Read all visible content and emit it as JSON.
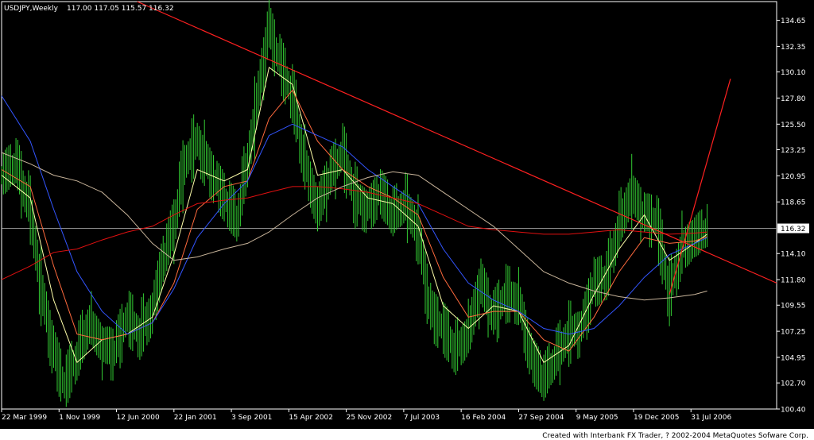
{
  "header": {
    "symbol_label": "USDJPY,Weekly",
    "ohlc": "117.00 117.05 115.57 116.32"
  },
  "footer": {
    "credit": "Created with Interbank FX Trader, ? 2002-2004 MetaQuotes Sofware Corp."
  },
  "colors": {
    "background": "#000000",
    "price_bars": "#33cc33",
    "trendline": "#ff2020",
    "ma_fast": "#ffffaa",
    "ma_medium": "#ff6a3d",
    "ma_slow_blue": "#3355ff",
    "ma_red_long": "#e01010",
    "ma_tan_long": "#c8b49a",
    "price_line": "#c0c0c0",
    "price_tag_bg": "#ffffff",
    "footer_bg": "#ffffff"
  },
  "chart_data": {
    "type": "line",
    "ylim": [
      100.4,
      136.3
    ],
    "y_ticks": [
      "134.65",
      "132.35",
      "130.10",
      "127.80",
      "125.50",
      "123.25",
      "120.95",
      "118.65",
      "116.32",
      "114.10",
      "111.80",
      "109.55",
      "107.25",
      "104.95",
      "102.70",
      "100.40"
    ],
    "y_tick_values": [
      134.65,
      132.35,
      130.1,
      127.8,
      125.5,
      123.25,
      120.95,
      118.65,
      116.32,
      114.1,
      111.8,
      109.55,
      107.25,
      104.95,
      102.7,
      100.4
    ],
    "x_ticks": [
      "22 Mar 1999",
      "1 Nov 1999",
      "12 Jun 2000",
      "22 Jan 2001",
      "3 Sep 2001",
      "15 Apr 2002",
      "25 Nov 2002",
      "7 Jul 2003",
      "16 Feb 2004",
      "27 Sep 2004",
      "9 May 2005",
      "19 Dec 2005",
      "31 Jul 2006"
    ],
    "current_price": 116.32,
    "x_range_dates": [
      "1999-03-22",
      "2007-06-30"
    ],
    "series": [
      {
        "name": "",
        "role": "price",
        "points": [
          [
            "1999-03-22",
            121.0
          ],
          [
            "1999-05-17",
            122.0
          ],
          [
            "1999-07-12",
            118.0
          ],
          [
            "1999-08-23",
            111.0
          ],
          [
            "1999-10-11",
            105.5
          ],
          [
            "1999-11-22",
            102.5
          ],
          [
            "2000-01-10",
            105.0
          ],
          [
            "2000-02-28",
            108.0
          ],
          [
            "2000-04-17",
            106.0
          ],
          [
            "2000-06-05",
            105.5
          ],
          [
            "2000-07-24",
            108.5
          ],
          [
            "2000-09-11",
            107.0
          ],
          [
            "2000-10-30",
            109.0
          ],
          [
            "2000-12-11",
            113.5
          ],
          [
            "2001-01-22",
            116.5
          ],
          [
            "2001-03-05",
            122.0
          ],
          [
            "2001-04-23",
            124.0
          ],
          [
            "2001-06-11",
            121.5
          ],
          [
            "2001-08-06",
            119.0
          ],
          [
            "2001-09-24",
            117.0
          ],
          [
            "2001-11-05",
            122.0
          ],
          [
            "2001-12-17",
            128.0
          ],
          [
            "2002-01-28",
            134.0
          ],
          [
            "2002-03-11",
            131.0
          ],
          [
            "2002-04-29",
            128.0
          ],
          [
            "2002-06-17",
            122.0
          ],
          [
            "2002-08-05",
            118.0
          ],
          [
            "2002-09-23",
            121.0
          ],
          [
            "2002-11-11",
            123.0
          ],
          [
            "2002-12-30",
            119.0
          ],
          [
            "2003-02-17",
            118.0
          ],
          [
            "2003-04-07",
            119.5
          ],
          [
            "2003-05-26",
            117.5
          ],
          [
            "2003-07-14",
            118.5
          ],
          [
            "2003-09-01",
            116.0
          ],
          [
            "2003-10-20",
            109.0
          ],
          [
            "2003-12-08",
            107.5
          ],
          [
            "2004-01-26",
            105.5
          ],
          [
            "2004-03-15",
            107.0
          ],
          [
            "2004-05-03",
            111.5
          ],
          [
            "2004-06-21",
            108.5
          ],
          [
            "2004-08-09",
            110.5
          ],
          [
            "2004-09-27",
            110.0
          ],
          [
            "2004-11-15",
            105.0
          ],
          [
            "2005-01-03",
            103.0
          ],
          [
            "2005-02-21",
            105.0
          ],
          [
            "2005-04-11",
            107.0
          ],
          [
            "2005-05-30",
            107.5
          ],
          [
            "2005-07-18",
            111.5
          ],
          [
            "2005-09-05",
            112.0
          ],
          [
            "2005-10-24",
            116.5
          ],
          [
            "2005-12-12",
            119.5
          ],
          [
            "2006-01-30",
            117.5
          ],
          [
            "2006-03-20",
            117.0
          ],
          [
            "2006-05-08",
            110.5
          ],
          [
            "2006-06-26",
            114.5
          ],
          [
            "2006-08-14",
            115.5
          ],
          [
            "2006-10-02",
            116.3
          ]
        ]
      },
      {
        "name": "",
        "role": "ma_fast",
        "points": [
          [
            "1999-03-22",
            121.0
          ],
          [
            "1999-07-12",
            119.0
          ],
          [
            "1999-10-11",
            110.0
          ],
          [
            "2000-01-10",
            104.5
          ],
          [
            "2000-04-17",
            106.5
          ],
          [
            "2000-07-24",
            107.0
          ],
          [
            "2000-10-30",
            108.5
          ],
          [
            "2001-01-22",
            114.0
          ],
          [
            "2001-04-23",
            121.5
          ],
          [
            "2001-08-06",
            120.5
          ],
          [
            "2001-11-05",
            121.5
          ],
          [
            "2002-01-28",
            130.5
          ],
          [
            "2002-04-29",
            129.0
          ],
          [
            "2002-08-05",
            121.0
          ],
          [
            "2002-11-11",
            121.5
          ],
          [
            "2003-02-17",
            119.0
          ],
          [
            "2003-05-26",
            118.5
          ],
          [
            "2003-09-01",
            116.5
          ],
          [
            "2003-12-08",
            109.5
          ],
          [
            "2004-03-15",
            107.5
          ],
          [
            "2004-06-21",
            109.5
          ],
          [
            "2004-09-27",
            109.0
          ],
          [
            "2005-01-03",
            104.5
          ],
          [
            "2005-04-11",
            106.0
          ],
          [
            "2005-07-18",
            110.5
          ],
          [
            "2005-10-24",
            114.5
          ],
          [
            "2006-01-30",
            117.5
          ],
          [
            "2006-05-08",
            113.5
          ],
          [
            "2006-08-14",
            115.0
          ],
          [
            "2006-10-02",
            115.8
          ]
        ]
      },
      {
        "name": "",
        "role": "ma_medium",
        "points": [
          [
            "1999-03-22",
            121.5
          ],
          [
            "1999-07-12",
            120.0
          ],
          [
            "1999-10-11",
            113.0
          ],
          [
            "2000-01-10",
            107.0
          ],
          [
            "2000-04-17",
            106.5
          ],
          [
            "2000-07-24",
            107.0
          ],
          [
            "2000-10-30",
            108.0
          ],
          [
            "2001-01-22",
            111.5
          ],
          [
            "2001-04-23",
            118.0
          ],
          [
            "2001-08-06",
            120.0
          ],
          [
            "2001-11-05",
            120.5
          ],
          [
            "2002-01-28",
            126.0
          ],
          [
            "2002-04-29",
            128.5
          ],
          [
            "2002-08-05",
            124.0
          ],
          [
            "2002-11-11",
            121.5
          ],
          [
            "2003-02-17",
            120.0
          ],
          [
            "2003-05-26",
            119.0
          ],
          [
            "2003-09-01",
            117.5
          ],
          [
            "2003-12-08",
            112.0
          ],
          [
            "2004-03-15",
            108.5
          ],
          [
            "2004-06-21",
            109.0
          ],
          [
            "2004-09-27",
            109.0
          ],
          [
            "2005-01-03",
            106.5
          ],
          [
            "2005-04-11",
            105.5
          ],
          [
            "2005-07-18",
            108.5
          ],
          [
            "2005-10-24",
            112.5
          ],
          [
            "2006-01-30",
            115.5
          ],
          [
            "2006-05-08",
            115.0
          ],
          [
            "2006-08-14",
            115.2
          ],
          [
            "2006-10-02",
            115.6
          ]
        ]
      },
      {
        "name": "",
        "role": "ma_slow_blue",
        "points": [
          [
            "1999-03-22",
            128.0
          ],
          [
            "1999-07-12",
            124.0
          ],
          [
            "1999-10-11",
            118.0
          ],
          [
            "2000-01-10",
            112.5
          ],
          [
            "2000-04-17",
            109.0
          ],
          [
            "2000-07-24",
            107.0
          ],
          [
            "2000-10-30",
            108.0
          ],
          [
            "2001-01-22",
            111.0
          ],
          [
            "2001-04-23",
            115.5
          ],
          [
            "2001-08-06",
            118.5
          ],
          [
            "2001-11-05",
            120.5
          ],
          [
            "2002-01-28",
            124.5
          ],
          [
            "2002-04-29",
            125.5
          ],
          [
            "2002-08-05",
            124.5
          ],
          [
            "2002-11-11",
            123.5
          ],
          [
            "2003-02-17",
            121.5
          ],
          [
            "2003-05-26",
            120.0
          ],
          [
            "2003-09-01",
            118.5
          ],
          [
            "2003-12-08",
            114.5
          ],
          [
            "2004-03-15",
            111.5
          ],
          [
            "2004-06-21",
            110.0
          ],
          [
            "2004-09-27",
            109.0
          ],
          [
            "2005-01-03",
            107.5
          ],
          [
            "2005-04-11",
            107.0
          ],
          [
            "2005-07-18",
            107.5
          ],
          [
            "2005-10-24",
            109.5
          ],
          [
            "2006-01-30",
            112.0
          ],
          [
            "2006-05-08",
            114.0
          ],
          [
            "2006-08-14",
            115.0
          ],
          [
            "2006-10-02",
            115.5
          ]
        ]
      },
      {
        "name": "",
        "role": "ma_red_long",
        "points": [
          [
            "1999-03-22",
            111.8
          ],
          [
            "1999-07-12",
            113.0
          ],
          [
            "1999-10-11",
            114.2
          ],
          [
            "2000-01-10",
            114.5
          ],
          [
            "2000-04-17",
            115.3
          ],
          [
            "2000-07-24",
            116.0
          ],
          [
            "2000-10-30",
            116.5
          ],
          [
            "2001-01-22",
            117.5
          ],
          [
            "2001-04-23",
            118.5
          ],
          [
            "2001-08-06",
            118.8
          ],
          [
            "2001-11-05",
            119.0
          ],
          [
            "2002-01-28",
            119.5
          ],
          [
            "2002-04-29",
            120.0
          ],
          [
            "2002-08-05",
            120.0
          ],
          [
            "2002-11-11",
            119.8
          ],
          [
            "2003-02-17",
            119.5
          ],
          [
            "2003-05-26",
            119.0
          ],
          [
            "2003-09-01",
            118.5
          ],
          [
            "2003-12-08",
            117.5
          ],
          [
            "2004-03-15",
            116.5
          ],
          [
            "2004-06-21",
            116.2
          ],
          [
            "2004-09-27",
            116.0
          ],
          [
            "2005-01-03",
            115.8
          ],
          [
            "2005-04-11",
            115.8
          ],
          [
            "2005-07-18",
            116.0
          ],
          [
            "2005-10-24",
            116.2
          ],
          [
            "2006-01-30",
            116.0
          ],
          [
            "2006-05-08",
            115.8
          ],
          [
            "2006-08-14",
            115.9
          ],
          [
            "2006-10-02",
            116.0
          ]
        ]
      },
      {
        "name": "",
        "role": "ma_tan_long",
        "points": [
          [
            "1999-03-22",
            123.0
          ],
          [
            "1999-07-12",
            122.0
          ],
          [
            "1999-10-11",
            121.0
          ],
          [
            "2000-01-10",
            120.5
          ],
          [
            "2000-04-17",
            119.5
          ],
          [
            "2000-07-24",
            117.5
          ],
          [
            "2000-10-30",
            115.0
          ],
          [
            "2001-01-22",
            113.5
          ],
          [
            "2001-04-23",
            113.8
          ],
          [
            "2001-08-06",
            114.5
          ],
          [
            "2001-11-05",
            115.0
          ],
          [
            "2002-01-28",
            116.0
          ],
          [
            "2002-04-29",
            117.5
          ],
          [
            "2002-08-05",
            119.0
          ],
          [
            "2002-11-11",
            120.0
          ],
          [
            "2003-02-17",
            120.8
          ],
          [
            "2003-05-26",
            121.3
          ],
          [
            "2003-09-01",
            121.0
          ],
          [
            "2003-12-08",
            119.5
          ],
          [
            "2004-03-15",
            118.0
          ],
          [
            "2004-06-21",
            116.5
          ],
          [
            "2004-09-27",
            114.5
          ],
          [
            "2005-01-03",
            112.5
          ],
          [
            "2005-04-11",
            111.5
          ],
          [
            "2005-07-18",
            110.8
          ],
          [
            "2005-10-24",
            110.3
          ],
          [
            "2006-01-30",
            110.0
          ],
          [
            "2006-05-08",
            110.2
          ],
          [
            "2006-08-14",
            110.5
          ],
          [
            "2006-10-02",
            110.8
          ]
        ]
      }
    ],
    "trendlines": [
      {
        "role": "down_trendline",
        "from": [
          "2000-09-01",
          136.3
        ],
        "to": [
          "2007-06-30",
          111.5
        ]
      },
      {
        "role": "up_trendline",
        "from": [
          "2006-05-08",
          110.5
        ],
        "to": [
          "2007-01-01",
          129.5
        ]
      }
    ]
  }
}
